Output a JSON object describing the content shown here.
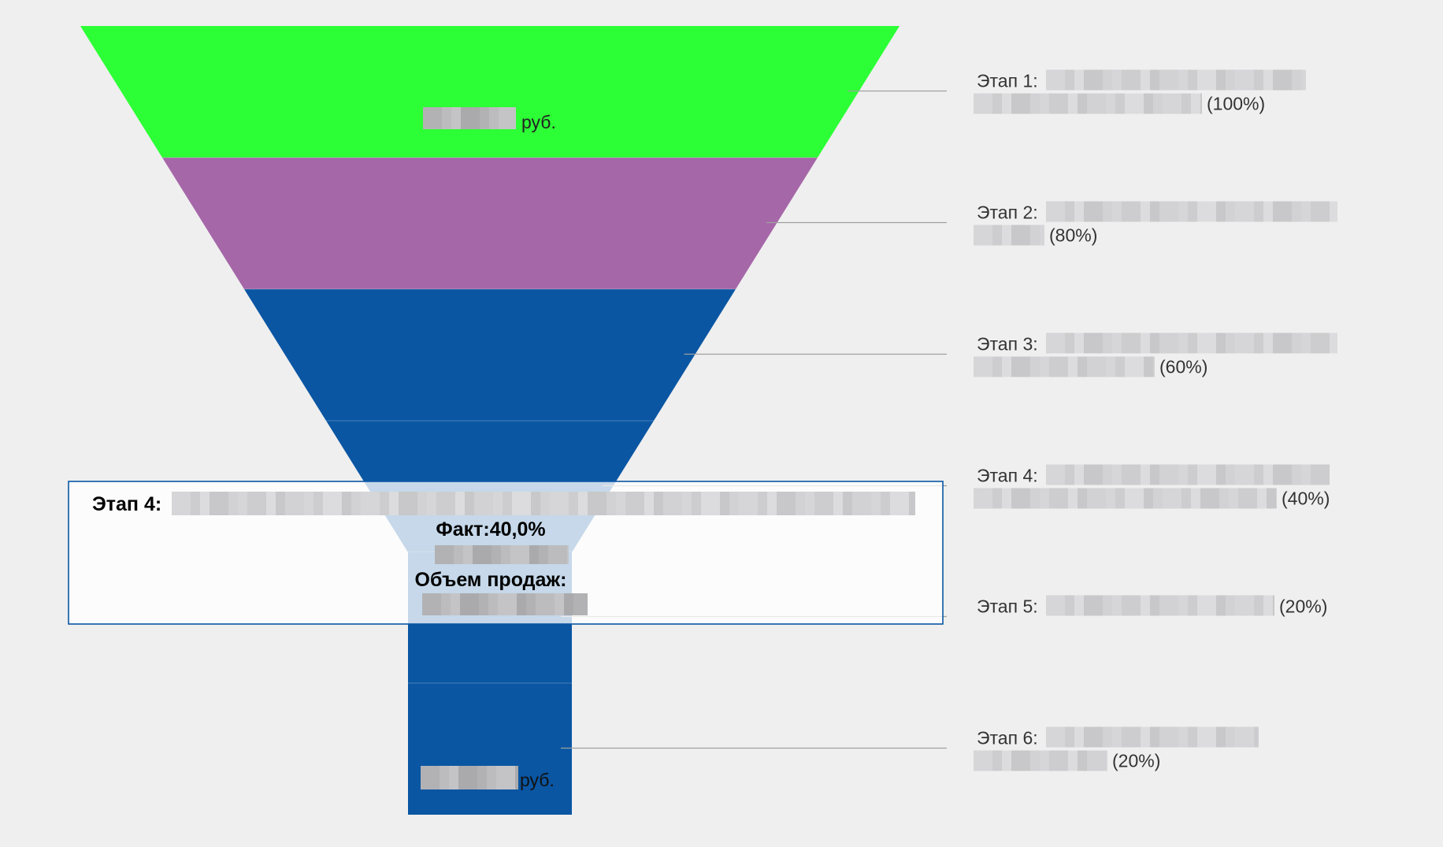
{
  "chart_data": {
    "type": "funnel",
    "currency_label": "руб.",
    "stages": [
      {
        "label": "Этап 1:",
        "percent_text": "(100%)",
        "percent": 100,
        "color": "#2cff35"
      },
      {
        "label": "Этап 2:",
        "percent_text": "(80%)",
        "percent": 80,
        "color": "#a567a8"
      },
      {
        "label": "Этап 3:",
        "percent_text": "(60%)",
        "percent": 60,
        "color": "#0a56a3"
      },
      {
        "label": "Этап 4:",
        "percent_text": "(40%)",
        "percent": 40,
        "color": "#0a56a3"
      },
      {
        "label": "Этап 5:",
        "percent_text": "(20%)",
        "percent": 20,
        "color": "#0a56a3"
      },
      {
        "label": "Этап 6:",
        "percent_text": "(20%)",
        "percent": 20,
        "color": "#0a56a3"
      }
    ],
    "tooltip": {
      "stage_label": "Этап 4:",
      "fact_label": "Факт:40,0%",
      "sales_label": "Объем продаж:"
    }
  }
}
